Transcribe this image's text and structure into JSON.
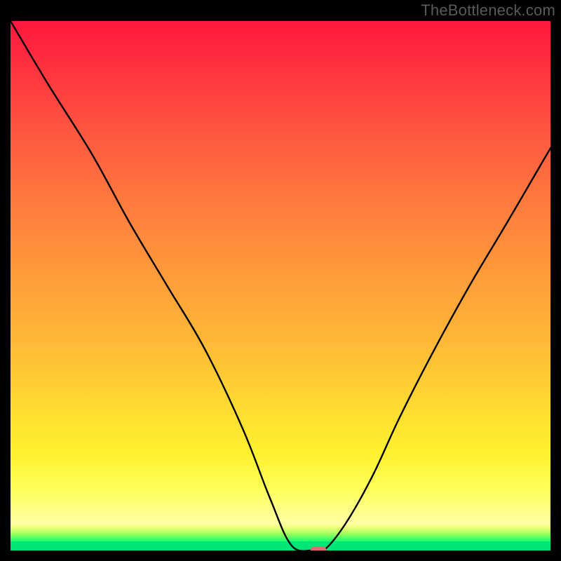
{
  "watermark": "TheBottleneck.com",
  "chart_data": {
    "type": "line",
    "title": "",
    "xlabel": "",
    "ylabel": "",
    "xlim": [
      0,
      100
    ],
    "ylim": [
      0,
      100
    ],
    "series": [
      {
        "name": "bottleneck-curve",
        "x": [
          0,
          7,
          15,
          22,
          29,
          36,
          43,
          48,
          52,
          56,
          58,
          62,
          67,
          72,
          78,
          85,
          92,
          100
        ],
        "values": [
          100,
          88,
          75,
          62,
          50,
          38,
          23,
          10,
          1,
          0,
          0,
          5,
          14,
          25,
          37,
          50,
          62,
          76
        ]
      }
    ],
    "marker": {
      "x": 57,
      "y": 0
    },
    "grid": false,
    "legend": false
  },
  "colors": {
    "frame": "#000000",
    "curve": "#000000",
    "marker": "#e06a6d",
    "green_band": "#00e676"
  }
}
